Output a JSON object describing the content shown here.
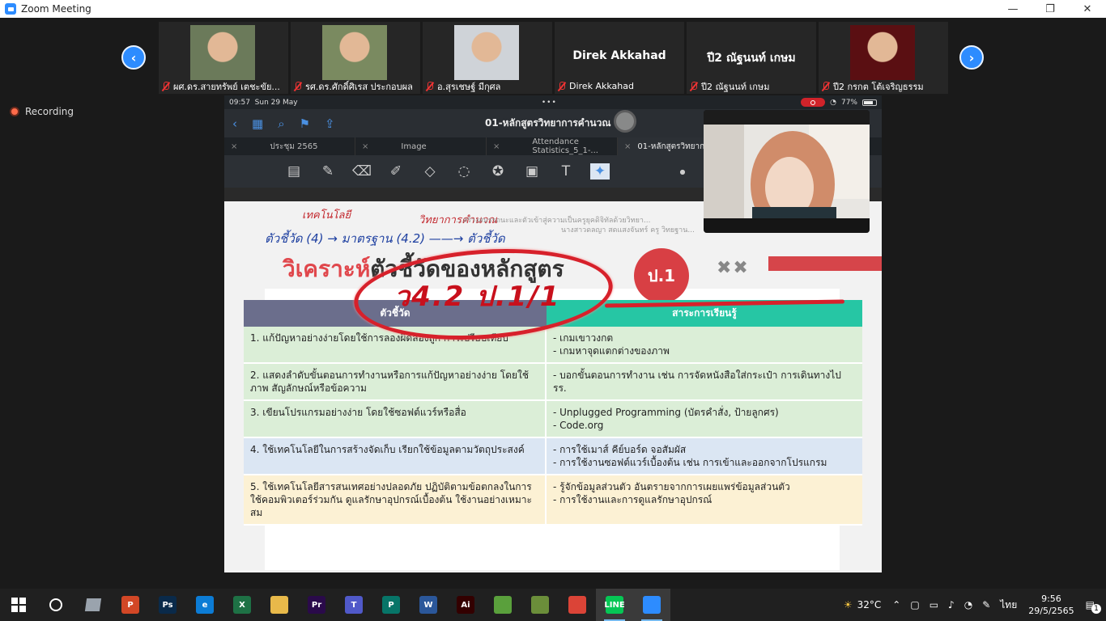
{
  "window": {
    "title": "Zoom Meeting"
  },
  "recording_label": "Recording",
  "participants": [
    {
      "label": "ผศ.ดร.สายทรัพย์ เตชะขัย...",
      "kind": "photo",
      "tone": "#6b7a5a"
    },
    {
      "label": "รศ.ดร.ศักดิ์ศิเรส ประกอบผล",
      "kind": "photo",
      "tone": "#7a8a60"
    },
    {
      "label": "อ.สุรเชษฐ์ มีกุศล",
      "kind": "photo",
      "tone": "#cfd3d8"
    },
    {
      "label": "Direk Akkahad",
      "kind": "name",
      "name_text": "Direk Akkahad"
    },
    {
      "label": "ปี2 ณัฐนนท์ เกษม",
      "kind": "name",
      "name_text": "ปี2 ณัฐนนท์ เกษม"
    },
    {
      "label": "ปี2 กรกต โต้เจริญธรรม",
      "kind": "photo",
      "tone": "#5a0f12"
    }
  ],
  "ipad": {
    "time": "09:57",
    "date": "Sun 29 May",
    "battery": "77%",
    "doc_title": "01-หลักสูตรวิทยาการคำนวณ",
    "tabs": [
      {
        "label": "ประชุม 2565"
      },
      {
        "label": "Image"
      },
      {
        "label": "Attendance Statistics_5_1-..."
      },
      {
        "label": "01-หลักสูตรวิทยาการ..."
      }
    ]
  },
  "slide": {
    "hw_1": "เทคโนโลยี",
    "hw_2": "วิทยาการคำนวณ",
    "hw_3": "ตัวชี้วัด (4) → มาตรฐาน (4.2) ——→ ตัวชี้วัด",
    "subtitle_1": "...สร้างสมรรถนะและตัวเข้าสู่ความเป็นครูยุคดิจิทัลด้วยวิทยา...",
    "subtitle_2": "นางสาวดลญา สดแสงจันทร์ ครู วิทยฐาน...",
    "heading_red": "วิเคราะห์",
    "heading_dark": "ตัวชี้วัดของหลักสูตร",
    "level": "ป.1",
    "annotation": "ว4.2 ป.1/1",
    "table_head_1": "ตัวชี้วัด",
    "table_head_2": "สาระการเรียนรู้",
    "rows": [
      {
        "c1": "1. แก้ปัญหาอย่างง่ายโดยใช้การลองผิดลองถูก การเปรียบเทียบ",
        "c2": "- เกมเขาวงกต\n- เกมหาจุดแตกต่างของภาพ",
        "color": "green"
      },
      {
        "c1": "2. แสดงลำดับขั้นตอนการทำงานหรือการแก้ปัญหาอย่างง่าย โดยใช้ภาพ สัญลักษณ์หรือข้อความ",
        "c2": "- บอกขั้นตอนการทำงาน เช่น การจัดหนังสือใส่กระเป๋า การเดินทางไป รร.",
        "color": "green"
      },
      {
        "c1": "3. เขียนโปรแกรมอย่างง่าย โดยใช้ซอฟต์แวร์หรือสื่อ",
        "c2": "- Unplugged Programming (บัตรคำสั่ง, ป้ายลูกศร)\n- Code.org",
        "color": "green"
      },
      {
        "c1": "4. ใช้เทคโนโลยีในการสร้างจัดเก็บ เรียกใช้ข้อมูลตามวัตถุประสงค์",
        "c2": "- การใช้เมาส์ คีย์บอร์ด จอสัมผัส\n- การใช้งานซอฟต์แวร์เบื้องต้น เช่น การเข้าและออกจากโปรแกรม",
        "color": "blue"
      },
      {
        "c1": "5. ใช้เทคโนโลยีสารสนเทศอย่างปลอดภัย ปฏิบัติตามข้อตกลงในการใช้คอมพิวเตอร์ร่วมกัน ดูแลรักษาอุปกรณ์เบื้องต้น ใช้งานอย่างเหมาะสม",
        "c2": "- รู้จักข้อมูลส่วนตัว อันตรายจากการเผยแพร่ข้อมูลส่วนตัว\n- การใช้งานและการดูแลรักษาอุปกรณ์",
        "color": "yellow"
      }
    ]
  },
  "taskbar": {
    "apps": [
      {
        "name": "powerpoint-icon",
        "text": "P",
        "color": "#d24726"
      },
      {
        "name": "photoshop-icon",
        "text": "Ps",
        "color": "#0a2a4a"
      },
      {
        "name": "edge-icon",
        "text": "e",
        "color": "#0c7cd5"
      },
      {
        "name": "excel-icon",
        "text": "X",
        "color": "#1e7145"
      },
      {
        "name": "file-explorer-icon",
        "text": "",
        "color": "#e8b94a"
      },
      {
        "name": "premiere-icon",
        "text": "Pr",
        "color": "#2a0a4a"
      },
      {
        "name": "teams-icon",
        "text": "T",
        "color": "#5059c9"
      },
      {
        "name": "publisher-icon",
        "text": "P",
        "color": "#077568"
      },
      {
        "name": "word-icon",
        "text": "W",
        "color": "#2b579a"
      },
      {
        "name": "illustrator-icon",
        "text": "Ai",
        "color": "#330000"
      },
      {
        "name": "stack-icon",
        "text": "",
        "color": "#5aa03c"
      },
      {
        "name": "minecraft-icon",
        "text": "",
        "color": "#6b8e3a"
      },
      {
        "name": "chrome-icon",
        "text": "",
        "color": "#db4437"
      },
      {
        "name": "line-icon",
        "text": "LINE",
        "color": "#06c755"
      },
      {
        "name": "zoom-icon",
        "text": "",
        "color": "#2d8cff"
      }
    ],
    "temperature": "32°C",
    "lang": "ไทย",
    "time": "9:56",
    "date": "29/5/2565",
    "notif_count": "1"
  }
}
